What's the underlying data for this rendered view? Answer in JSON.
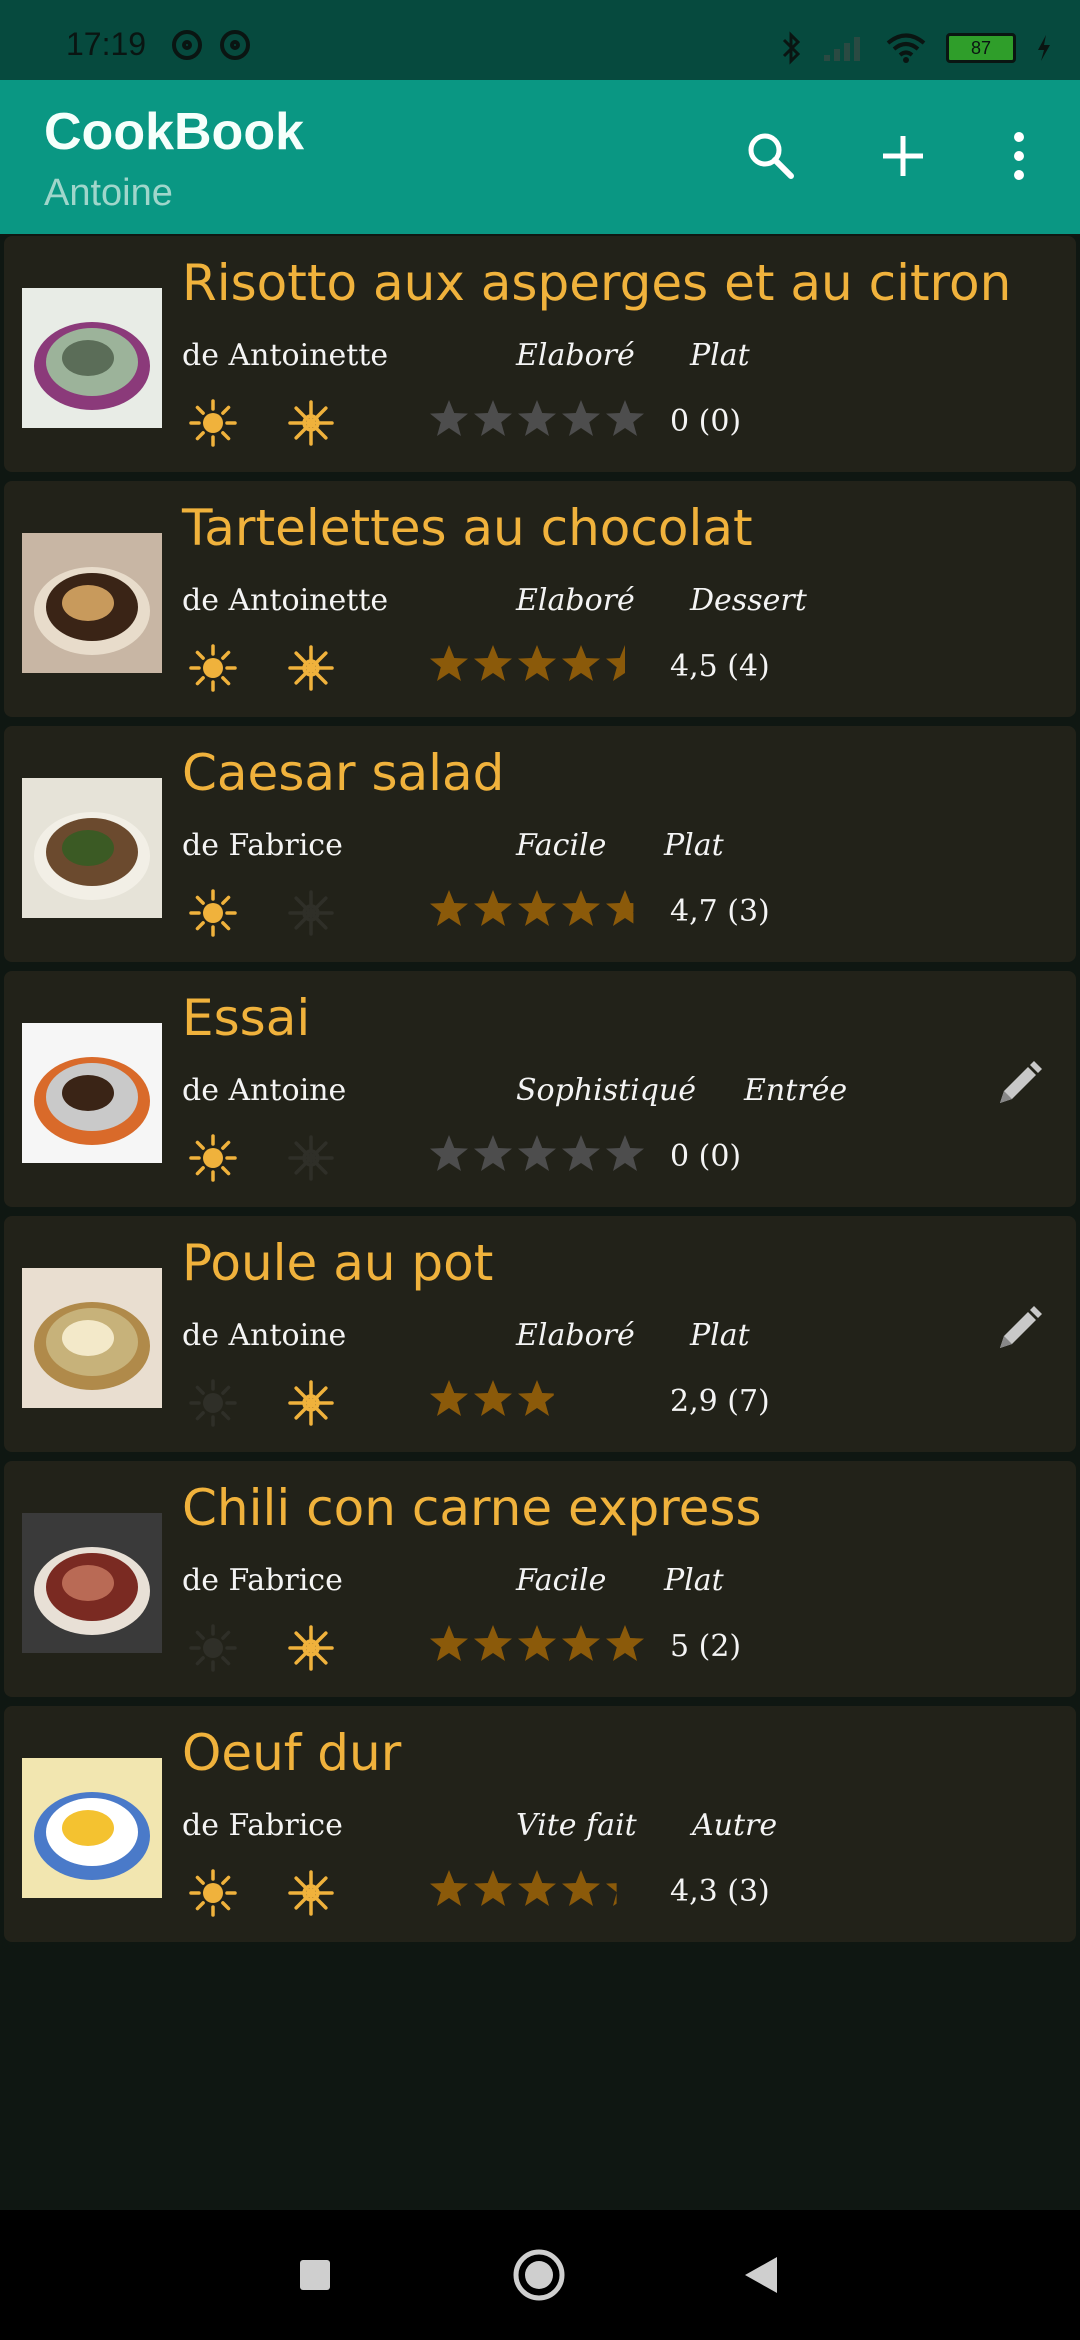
{
  "status_bar": {
    "time": "17:19",
    "battery": "87"
  },
  "app_bar": {
    "title": "CookBook",
    "subtitle": "Antoine"
  },
  "colors": {
    "accent": "#f0b23c",
    "app_bar": "#0a9783",
    "star_on": "#8b5a0a",
    "star_off": "#4d4d4d"
  },
  "recipes": [
    {
      "title": "Risotto aux asperges et au citron",
      "author": "de Antoinette",
      "difficulty": "Elaboré",
      "category": "Plat",
      "rating_text": "0 (0)",
      "rating": 0,
      "summer": true,
      "winter": true,
      "editable": false,
      "image_icon": "risotto-photo"
    },
    {
      "title": "Tartelettes au chocolat",
      "author": "de Antoinette",
      "difficulty": "Elaboré",
      "category": "Dessert",
      "rating_text": "4,5 (4)",
      "rating": 4.5,
      "summer": true,
      "winter": true,
      "editable": false,
      "image_icon": "tart-photo"
    },
    {
      "title": "Caesar salad",
      "author": "de Fabrice",
      "difficulty": "Facile",
      "category": "Plat",
      "rating_text": "4,7 (3)",
      "rating": 4.7,
      "summer": true,
      "winter": false,
      "editable": false,
      "image_icon": "salad-photo"
    },
    {
      "title": "Essai",
      "author": "de Antoine",
      "difficulty": "Sophistiqué",
      "category": "Entrée",
      "rating_text": "0 (0)",
      "rating": 0,
      "summer": true,
      "winter": false,
      "editable": true,
      "image_icon": "stew-pot-photo"
    },
    {
      "title": "Poule au pot",
      "author": "de Antoine",
      "difficulty": "Elaboré",
      "category": "Plat",
      "rating_text": "2,9 (7)",
      "rating": 2.9,
      "summer": false,
      "winter": true,
      "editable": true,
      "image_icon": "chicken-photo"
    },
    {
      "title": "Chili con carne express",
      "author": "de Fabrice",
      "difficulty": "Facile",
      "category": "Plat",
      "rating_text": "5 (2)",
      "rating": 5,
      "summer": false,
      "winter": true,
      "editable": false,
      "image_icon": "chili-photo"
    },
    {
      "title": "Oeuf dur",
      "author": "de Fabrice",
      "difficulty": "Vite fait",
      "category": "Autre",
      "rating_text": "4,3 (3)",
      "rating": 4.3,
      "summer": true,
      "winter": true,
      "editable": false,
      "image_icon": "egg-photo"
    }
  ]
}
